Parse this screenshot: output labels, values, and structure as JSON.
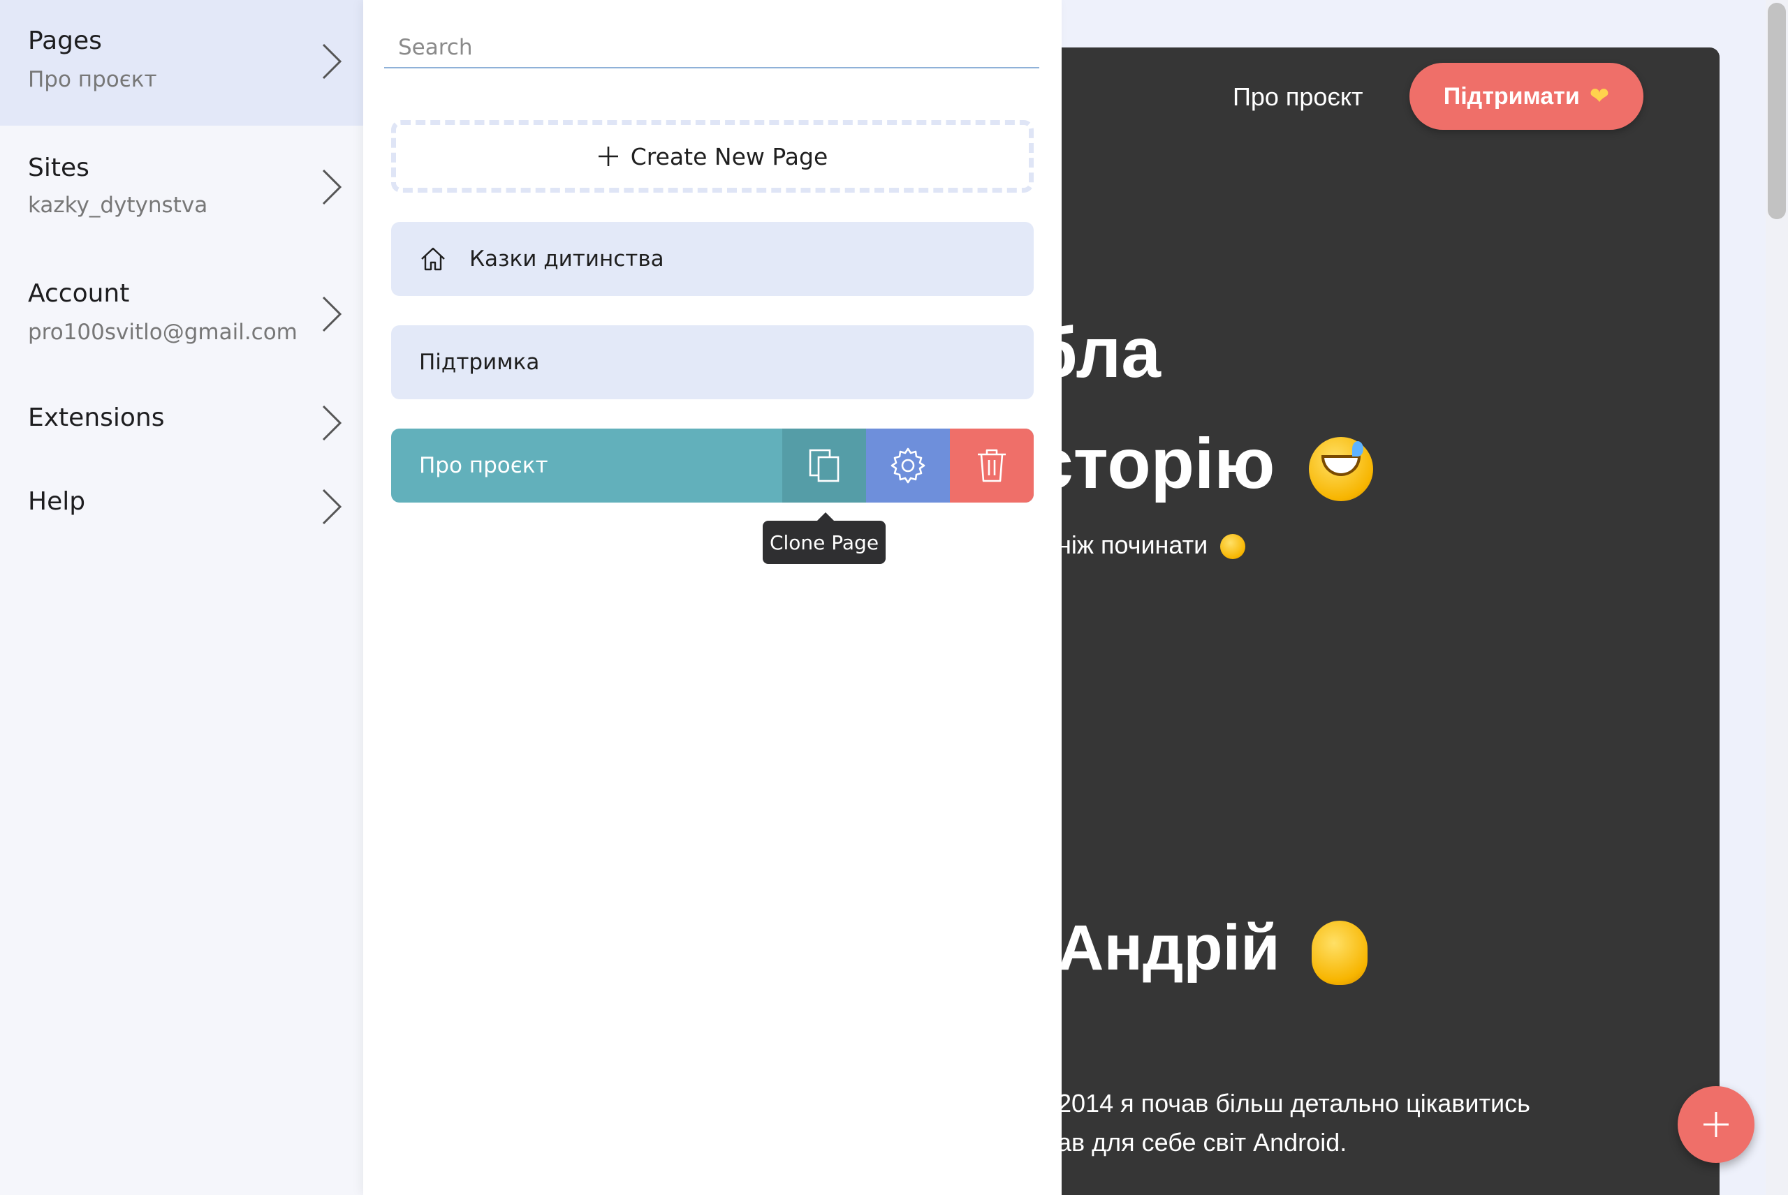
{
  "sidebar": {
    "items": [
      {
        "title": "Pages",
        "subtitle": "Про проєкт"
      },
      {
        "title": "Sites",
        "subtitle": "kazky_dytynstva"
      },
      {
        "title": "Account",
        "subtitle": "pro100svitlo@gmail.com"
      },
      {
        "title": "Extensions",
        "subtitle": ""
      },
      {
        "title": "Help",
        "subtitle": ""
      }
    ],
    "active_index": 0
  },
  "pages_panel": {
    "search_placeholder": "Search",
    "search_value": "",
    "create_label": "Create New Page",
    "pages": [
      {
        "name": "Казки дитинства",
        "icon": "home-icon"
      },
      {
        "name": "Підтримка",
        "icon": ""
      },
      {
        "name": "Про проєкт",
        "icon": ""
      }
    ],
    "selected_page_index": 2,
    "actions": [
      "copy-icon",
      "gear-icon",
      "trash-icon"
    ],
    "tooltip": "Clone Page"
  },
  "preview": {
    "nav_link": "Про проєкт",
    "support_button": "Підтримати",
    "heading_line1": "бла",
    "heading_line2": "сторію",
    "subtext": "ніж починати",
    "heading2": "Андрій",
    "para_line1": "2014 я почав більш детально цікавитись",
    "para_line2": "ав для себе світ Android."
  },
  "colors": {
    "accent_teal": "#62b0bb",
    "accent_blue": "#6e8fdb",
    "accent_red": "#ef6f69",
    "preview_bg": "#363636"
  }
}
